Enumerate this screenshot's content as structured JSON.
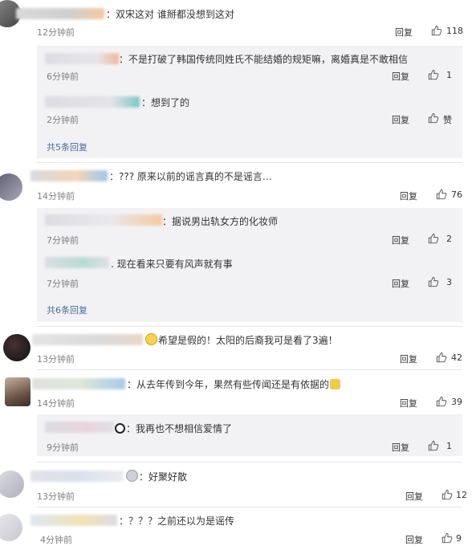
{
  "comments": [
    {
      "text": "：双宋这对 谁掰都没想到这对",
      "time": "12分钟前",
      "reply_label": "回复",
      "likes": "118",
      "replies": [
        {
          "text": "：不是打破了韩国传统同姓氏不能结婚的规矩嘛，离婚真是不敢相信",
          "time": "6分钟前",
          "reply_label": "回复",
          "likes": "1"
        },
        {
          "text": "：想到了的",
          "time": "2分钟前",
          "reply_label": "回复",
          "likes": "赞"
        }
      ],
      "more_label": "共5条回复"
    },
    {
      "text": "：??? 原来以前的谣言真的不是谣言…",
      "time": "14分钟前",
      "reply_label": "回复",
      "likes": "76",
      "replies": [
        {
          "text": "：据说男出轨女方的化妆师",
          "time": "7分钟前",
          "reply_label": "回复",
          "likes": "2"
        },
        {
          "text": ". 现在看来只要有风声就有事",
          "time": "7分钟前",
          "reply_label": "回复",
          "likes": "3"
        }
      ],
      "more_label": "共6条回复"
    },
    {
      "text": "希望是假的！太阳的后裔我可是看了3遍！",
      "time": "13分钟前",
      "reply_label": "回复",
      "likes": "42"
    },
    {
      "text": "：从去年传到今年，果然有些传闻还是有依据的",
      "time": "14分钟前",
      "reply_label": "回复",
      "likes": "39",
      "replies": [
        {
          "text": "：我再也不想相信爱情了",
          "time": "9分钟前",
          "reply_label": "回复",
          "likes": "1"
        }
      ]
    },
    {
      "text": "：好聚好散",
      "time": "13分钟前",
      "reply_label": "回复",
      "likes": "12"
    },
    {
      "text": "：？？？之前还以为是谣传",
      "time": "4分钟前",
      "reply_label": "回复",
      "likes": "9"
    }
  ],
  "colors": {
    "link": "#4a6b9c",
    "reply_bg": "#f2f2f5",
    "time": "#808080"
  },
  "icons": {
    "like": "thumb-up-icon"
  }
}
